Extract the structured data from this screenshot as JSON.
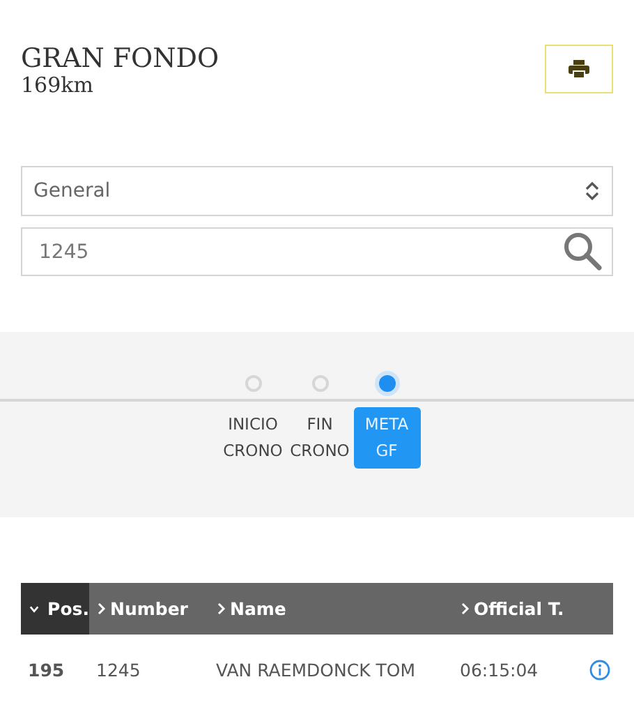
{
  "header": {
    "title": "GRAN FONDO",
    "subtitle": "169km"
  },
  "category_select": {
    "value": "General"
  },
  "search": {
    "value": "1245"
  },
  "checkpoints": [
    {
      "label": "INICIO CRONO",
      "selected": false
    },
    {
      "label": "FIN CRONO",
      "selected": false
    },
    {
      "label": "META GF",
      "selected": true
    }
  ],
  "table": {
    "columns": [
      {
        "label": "Pos.",
        "sorted": true
      },
      {
        "label": "Number",
        "sorted": false
      },
      {
        "label": "Name",
        "sorted": false
      },
      {
        "label": "Official T.",
        "sorted": false
      }
    ],
    "rows": [
      {
        "cells": [
          "195",
          "1245",
          "VAN RAEMDONCK TOM",
          "06:15:04"
        ]
      }
    ]
  }
}
